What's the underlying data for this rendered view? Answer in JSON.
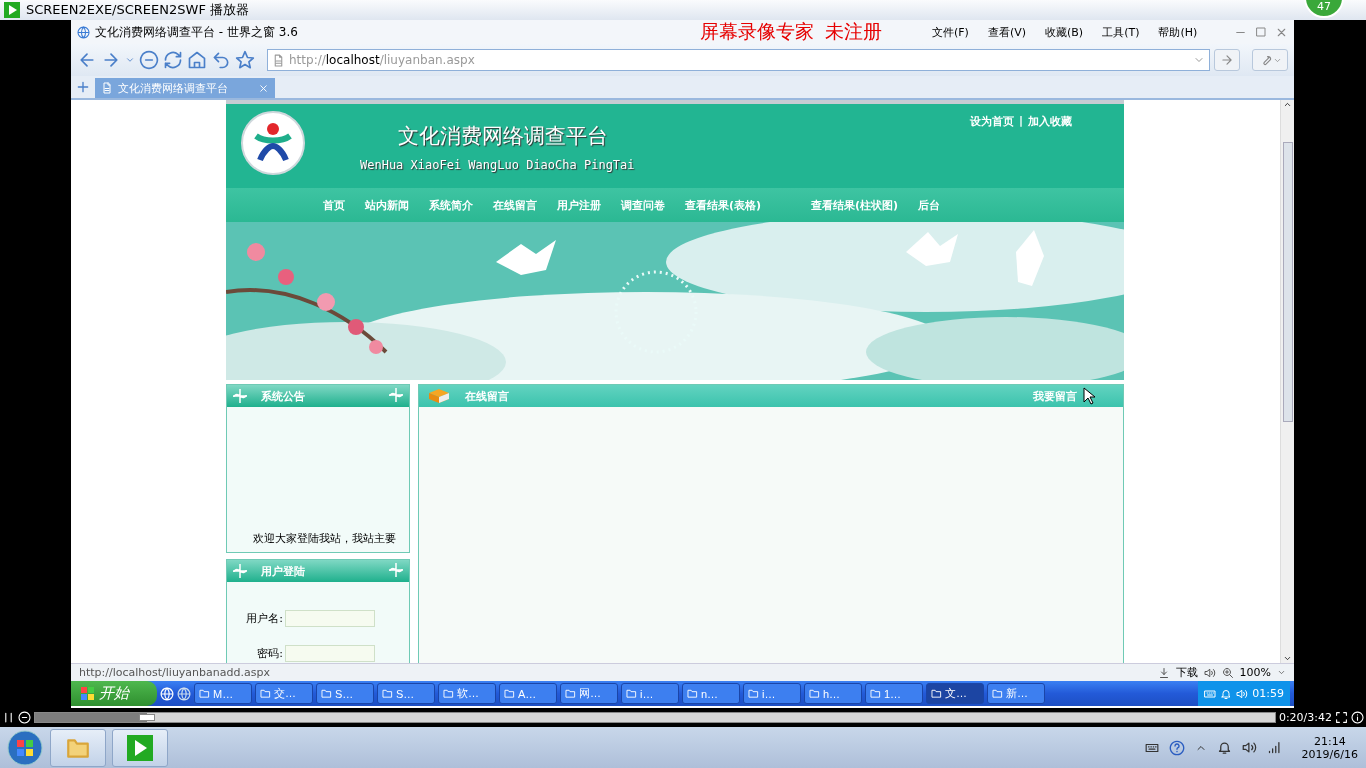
{
  "player": {
    "title": "SCREEN2EXE/SCREEN2SWF 播放器",
    "badge": "47",
    "time": "0:20/3:42",
    "level": 0.09
  },
  "browser": {
    "title": "文化消费网络调查平台 - 世界之窗 3.6",
    "watermark": [
      "屏幕录像专家",
      "未注册"
    ],
    "menu": [
      "文件(F)",
      "查看(V)",
      "收藏(B)",
      "工具(T)",
      "帮助(H)"
    ],
    "address": {
      "scheme": "http://",
      "host": "localhost",
      "path": "/liuyanban.aspx"
    },
    "tabs": [
      {
        "label": "文化消费网络调查平台",
        "selected": true
      }
    ],
    "status": {
      "url": "http://localhost/liuyanbanadd.aspx",
      "download": "下载",
      "zoom": "100%"
    }
  },
  "site": {
    "title": "文化消费网络调查平台",
    "subtitle": "WenHua XiaoFei WangLuo DiaoCha PingTai",
    "top_links": [
      "设为首页",
      "加入收藏"
    ],
    "top_links_separator": "|",
    "nav": [
      "首页",
      "站内新闻",
      "系统简介",
      "在线留言",
      "用户注册",
      "调查问卷",
      "查看结果(表格)",
      "查看结果(柱状图)",
      "后台"
    ],
    "notice": {
      "title": "系统公告",
      "text": "欢迎大家登陆我站，我站主要"
    },
    "login": {
      "title": "用户登陆",
      "fields": [
        {
          "label": "用户名:"
        },
        {
          "label": "密码:"
        }
      ]
    },
    "messages": {
      "title": "在线留言",
      "action": "我要留言"
    }
  },
  "xp_taskbar": {
    "start": "开始",
    "items": [
      {
        "label": "M…",
        "selected": false
      },
      {
        "label": "交…",
        "selected": false
      },
      {
        "label": "S…",
        "selected": false
      },
      {
        "label": "S…",
        "selected": false
      },
      {
        "label": "软…",
        "selected": false
      },
      {
        "label": "A…",
        "selected": false
      },
      {
        "label": "网…",
        "selected": false
      },
      {
        "label": "i…",
        "selected": false
      },
      {
        "label": "n…",
        "selected": false
      },
      {
        "label": "i…",
        "selected": false
      },
      {
        "label": "h…",
        "selected": false
      },
      {
        "label": "1…",
        "selected": false
      },
      {
        "label": "文…",
        "selected": true
      },
      {
        "label": "新…",
        "selected": false
      }
    ],
    "clock": "01:59"
  },
  "win7": {
    "clock": "21:14",
    "date": "2019/6/16"
  }
}
